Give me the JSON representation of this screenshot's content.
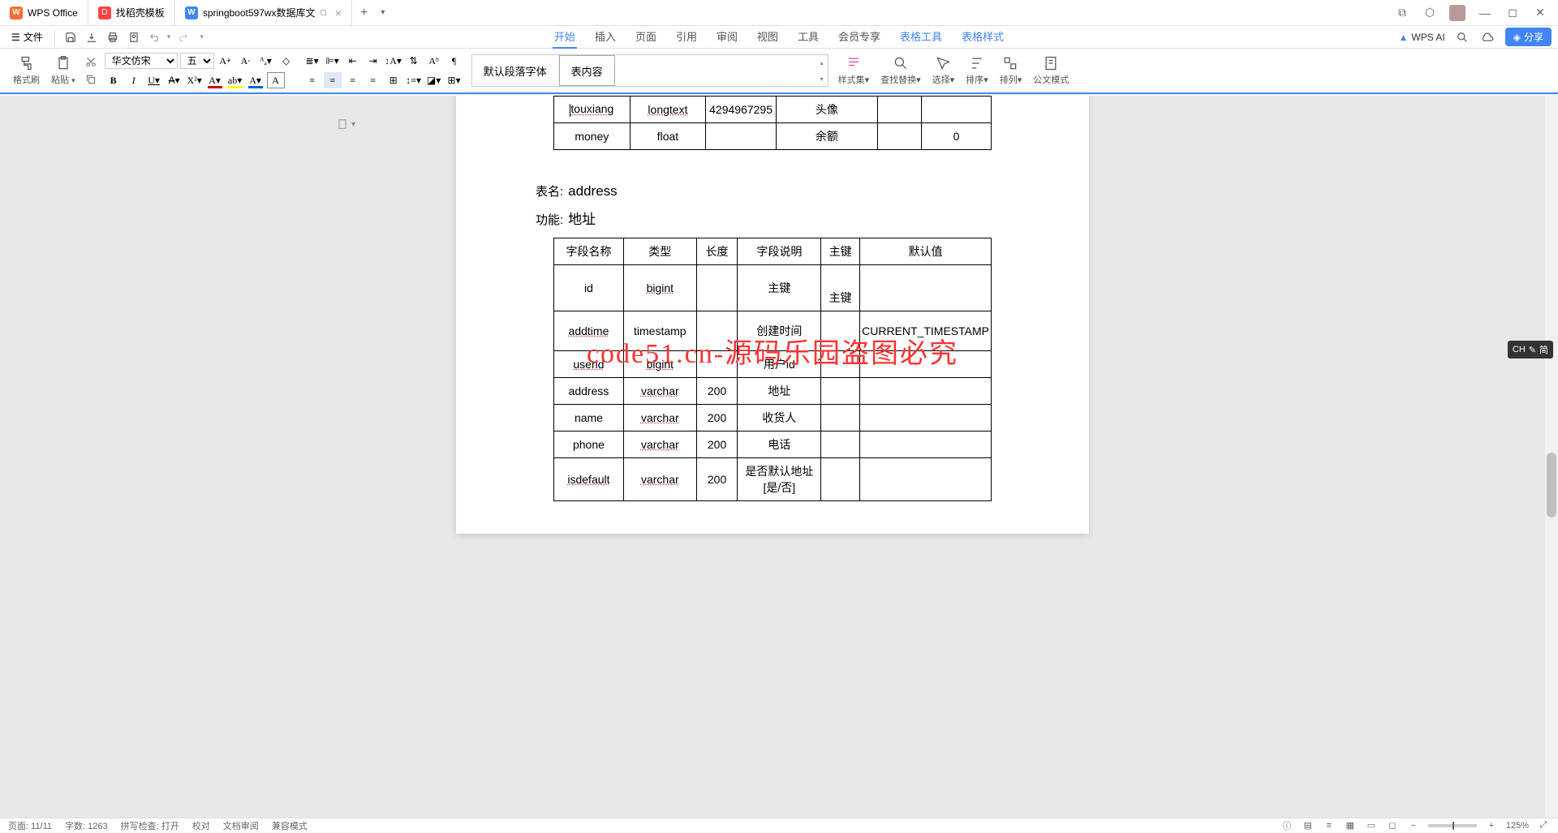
{
  "titlebar": {
    "tabs": [
      {
        "icon": "wps",
        "label": "WPS Office"
      },
      {
        "icon": "docer",
        "label": "找稻壳模板"
      },
      {
        "icon": "doc",
        "label": "springboot597wx数据库文",
        "active": true,
        "closable": true
      }
    ]
  },
  "quickaccess": {
    "menu_label": "文件"
  },
  "menus": {
    "items": [
      "开始",
      "插入",
      "页面",
      "引用",
      "审阅",
      "视图",
      "工具",
      "会员专享",
      "表格工具",
      "表格样式"
    ],
    "active": "开始"
  },
  "ai": {
    "label": "WPS AI"
  },
  "share": {
    "label": "分享"
  },
  "ribbon": {
    "format_painter": "格式刷",
    "paste": "粘贴",
    "font_name": "华文仿宋",
    "font_size": "五号",
    "style_default": "默认段落字体",
    "style_table": "表内容",
    "styleset": "样式集",
    "find": "查找替换",
    "select": "选择",
    "sort": "排序",
    "arrange": "排列",
    "official": "公文模式"
  },
  "document": {
    "table1": {
      "rows": [
        {
          "c1": "touxiang",
          "c2": "longtext",
          "c3": "4294967295",
          "c4": "头像",
          "c5": "",
          "c6": ""
        },
        {
          "c1": "money",
          "c2": "float",
          "c3": "",
          "c4": "余额",
          "c5": "",
          "c6": "0"
        }
      ]
    },
    "caption_table_label": "表名:",
    "caption_table_value": "address",
    "caption_func_label": "功能:",
    "caption_func_value": "地址",
    "table2": {
      "headers": [
        "字段名称",
        "类型",
        "长度",
        "字段说明",
        "主键",
        "默认值"
      ],
      "rows": [
        {
          "c1": "id",
          "c2": "bigint",
          "c3": "",
          "c4": "主键",
          "c5": "主键",
          "c6": ""
        },
        {
          "c1": "addtime",
          "c2": "timestamp",
          "c3": "",
          "c4": "创建时间",
          "c5": "",
          "c6": "CURRENT_TIMESTAMP"
        },
        {
          "c1": "userid",
          "c2": "bigint",
          "c3": "",
          "c4": "用户id",
          "c5": "",
          "c6": ""
        },
        {
          "c1": "address",
          "c2": "varchar",
          "c3": "200",
          "c4": "地址",
          "c5": "",
          "c6": ""
        },
        {
          "c1": "name",
          "c2": "varchar",
          "c3": "200",
          "c4": "收货人",
          "c5": "",
          "c6": ""
        },
        {
          "c1": "phone",
          "c2": "varchar",
          "c3": "200",
          "c4": "电话",
          "c5": "",
          "c6": ""
        },
        {
          "c1": "isdefault",
          "c2": "varchar",
          "c3": "200",
          "c4": "是否默认地址[是/否]",
          "c5": "",
          "c6": ""
        }
      ]
    },
    "watermark": "code51.cn-源码乐园盗图必究"
  },
  "ime": {
    "label": "CH",
    "sub": "简"
  },
  "statusbar": {
    "page": "页面: 11/11",
    "words": "字数: 1263",
    "spell": "拼写检查: 打开",
    "proof": "校对",
    "docs": "文档审阅",
    "mode": "兼容模式",
    "zoom": "125%"
  }
}
